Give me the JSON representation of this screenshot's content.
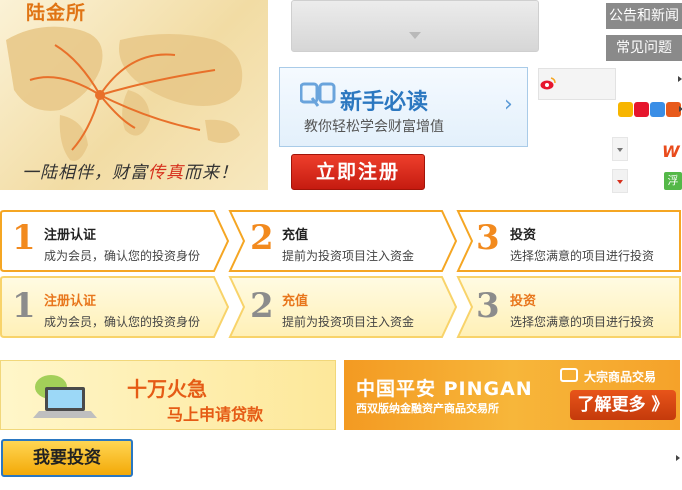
{
  "hero": {
    "brand": "陆金所",
    "slogan_pre": "一陆相伴，财富",
    "slogan_highlight": "传真",
    "slogan_post": "而来！"
  },
  "guide": {
    "title": "新手必读",
    "subtitle": "教你轻松学会财富增值"
  },
  "register": {
    "label": "立即注册"
  },
  "sidebar": {
    "news_label": "公告和新闻",
    "faq_label": "常见问题"
  },
  "icons": {
    "weibo": "weibo-icon",
    "w_label": "W",
    "fu_label": "浮"
  },
  "steps_active": [
    {
      "num": "1",
      "title": "注册认证",
      "desc": "成为会员，确认您的投资身份"
    },
    {
      "num": "2",
      "title": "充值",
      "desc": "提前为投资项目注入资金"
    },
    {
      "num": "3",
      "title": "投资",
      "desc": "选择您满意的项目进行投资"
    }
  ],
  "steps_hover": [
    {
      "num": "1",
      "title": "注册认证",
      "desc": "成为会员，确认您的投资身份"
    },
    {
      "num": "2",
      "title": "充值",
      "desc": "提前为投资项目注入资金"
    },
    {
      "num": "3",
      "title": "投资",
      "desc": "选择您满意的项目进行投资"
    }
  ],
  "loan_banner": {
    "line1": "十万火急",
    "line2": "马上申请贷款"
  },
  "pingan_banner": {
    "brand": "中国平安 PINGAN",
    "exchange": "西双版纳金融资产商品交易所",
    "tag": "大宗商品交易",
    "more": "了解更多 》"
  },
  "invest_button": {
    "label": "我要投资"
  },
  "colors": {
    "orange": "#f39a22",
    "red": "#d6301d",
    "blue": "#2c78c0"
  }
}
